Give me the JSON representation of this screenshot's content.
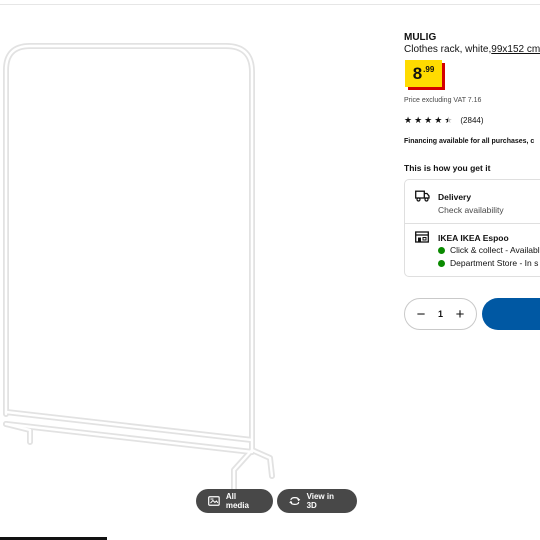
{
  "product": {
    "name": "MULIG",
    "description_prefix": "Clothes rack, white,",
    "dimensions": "99x152 cm",
    "price_integer": "8",
    "price_decimal": ".99",
    "vat_text": "Price excluding VAT 7.16",
    "rating_value": 4.5,
    "reviews_count": "(2844)",
    "financing_text": "Financing available for all purchases, c"
  },
  "fulfilment": {
    "heading": "This is how you get it",
    "delivery": {
      "icon": "truck-icon",
      "title": "Delivery",
      "subtitle": "Check availability"
    },
    "store": {
      "icon": "store-icon",
      "title": "IKEA IKEA Espoo",
      "click_collect": "Click & collect - Availabl",
      "department": "Department Store - In s",
      "status_color": "#0a8a00"
    }
  },
  "purchase": {
    "quantity": "1",
    "decrement_icon": "minus-icon",
    "increment_icon": "plus-icon",
    "add_button_color": "#0058a3"
  },
  "media": {
    "all_media_label": "All media",
    "view_3d_label": "View in 3D"
  },
  "colors": {
    "price_yellow": "#ffdb00",
    "price_shadow": "#d40000",
    "media_button_bg": "#484848"
  }
}
